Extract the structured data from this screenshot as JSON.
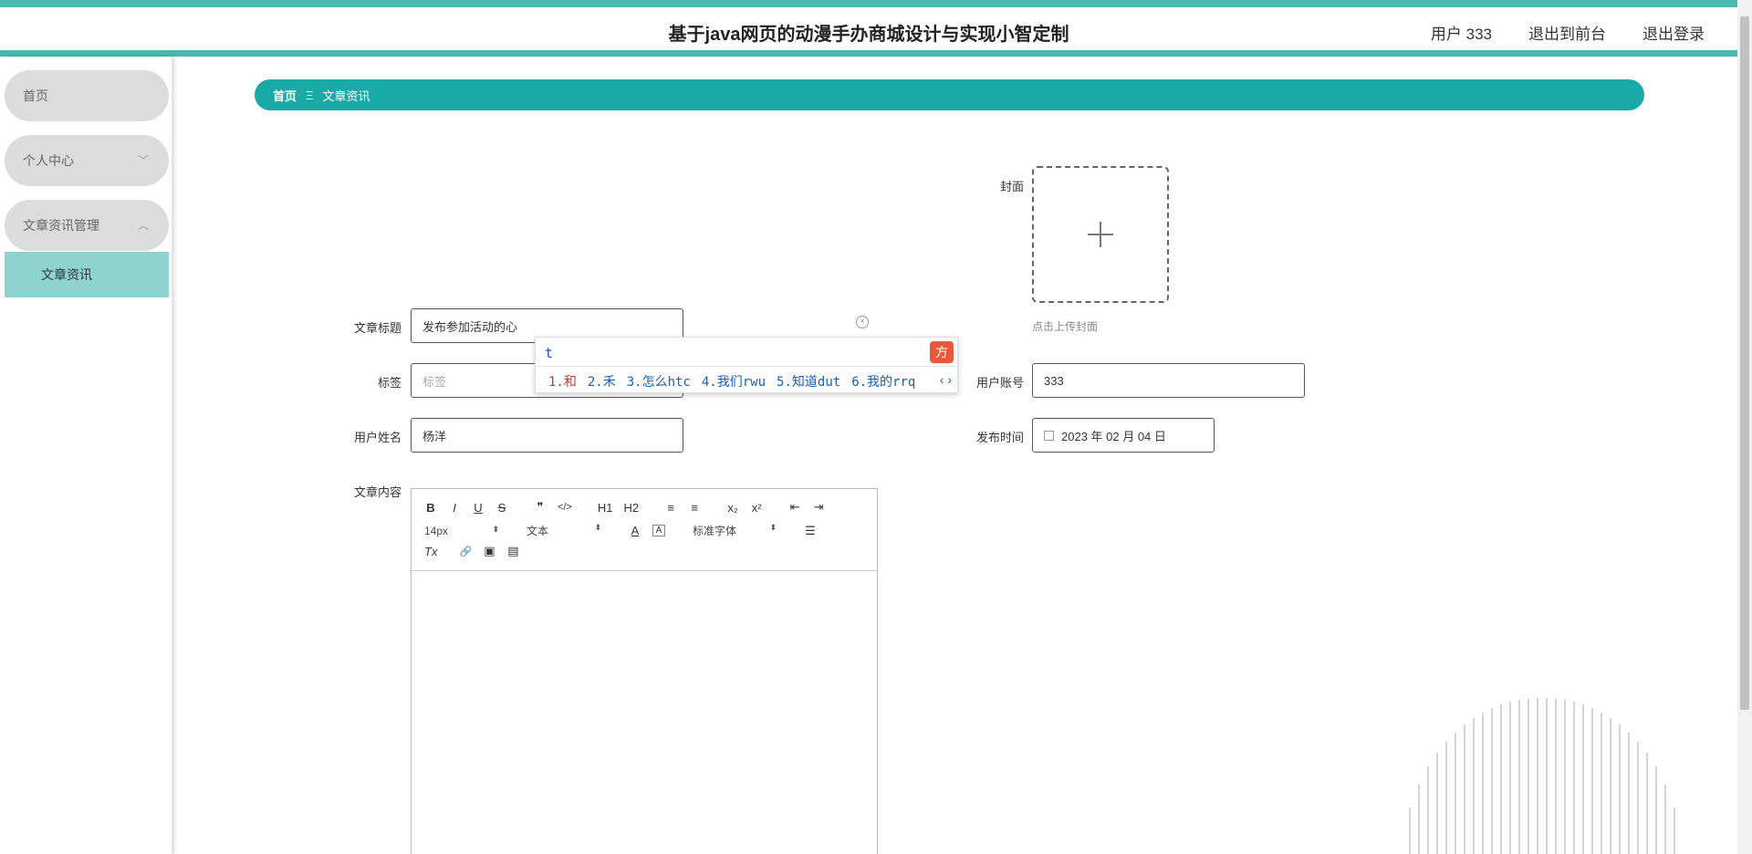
{
  "header": {
    "title": "基于java网页的动漫手办商城设计与实现小智定制",
    "links": [
      "用户 333",
      "退出到前台",
      "退出登录"
    ]
  },
  "sidebar": {
    "items": [
      {
        "label": "首页"
      },
      {
        "label": "个人中心"
      },
      {
        "label": "文章资讯管理"
      }
    ],
    "subitem": "文章资讯"
  },
  "breadcrumb": {
    "home": "首页",
    "separator": "Ξ",
    "current": "文章资讯"
  },
  "form": {
    "cover": {
      "label": "封面",
      "tip": "点击上传封面"
    },
    "title": {
      "label": "文章标题",
      "value": "发布参加活动的心"
    },
    "tags": {
      "label": "标签",
      "placeholder": "标签"
    },
    "account": {
      "label": "用户账号",
      "value": "333"
    },
    "name": {
      "label": "用户姓名",
      "value": "杨洋"
    },
    "publish_time": {
      "label": "发布时间",
      "value": "2023 年 02 月 04 日"
    },
    "content": {
      "label": "文章内容"
    }
  },
  "editor": {
    "row1": [
      "B",
      "I",
      "U",
      "S",
      "❞",
      "</>",
      "H1",
      "H2",
      "≡",
      "≡",
      "x₂",
      "x²",
      "⇤",
      "⇥"
    ],
    "font_size": "14px",
    "block_type": "文本",
    "font_family": "标准字体",
    "row3": [
      "Tx",
      "🔗",
      "▣",
      "▤"
    ]
  },
  "ime": {
    "input": "t",
    "candidates": [
      "1.和",
      "2.禾",
      "3.怎么htc",
      "4.我们rwu",
      "5.知道dut",
      "6.我的rrq"
    ],
    "nav": "‹ ›"
  },
  "colors": {
    "accent": "#1ba9a6",
    "header_border": "#4cb7ae",
    "submenu_active": "#8fd3cf",
    "pill": "#dcdcdc"
  }
}
